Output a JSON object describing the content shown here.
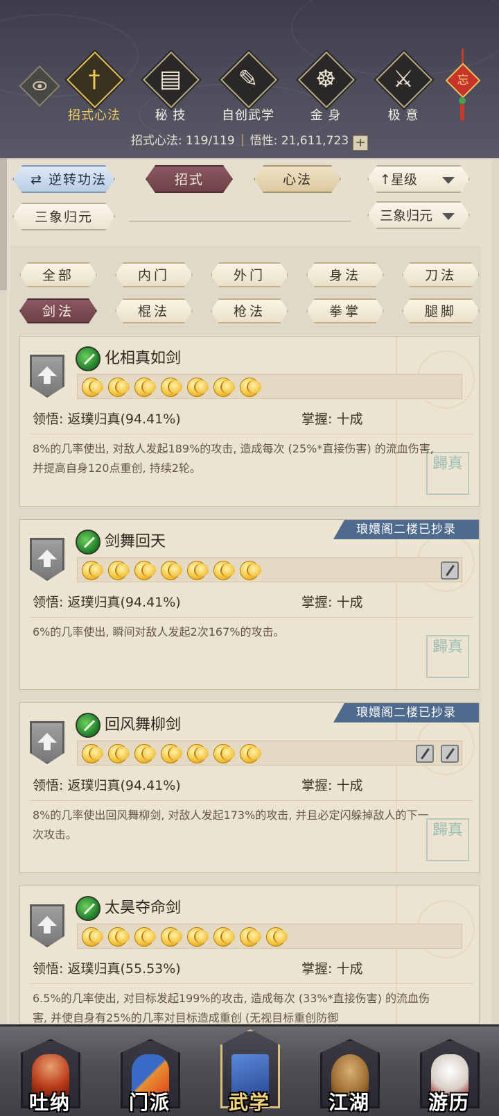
{
  "header": {
    "tabs": [
      {
        "label": "招式心法",
        "icon": "sword-icon",
        "glyph": "†",
        "active": true
      },
      {
        "label": "秘 技",
        "icon": "book-icon",
        "glyph": "▤",
        "active": false
      },
      {
        "label": "自创武学",
        "icon": "scroll-icon",
        "glyph": "✎",
        "active": false
      },
      {
        "label": "金 身",
        "icon": "meditation-icon",
        "glyph": "☸",
        "active": false
      },
      {
        "label": "极 意",
        "icon": "martial-stance-icon",
        "glyph": "⚔",
        "active": false
      }
    ],
    "charm_text": "忘",
    "stats": {
      "skill_label": "招式心法: 119/119",
      "insight_label": "悟性: 21,611,723",
      "plus": "+"
    }
  },
  "controls": {
    "reverse_button": "逆转功法",
    "moves_tab": "招式",
    "heart_tab": "心法",
    "sort_select": "星级",
    "sort_arrow": "↑",
    "left_filter": "三象归元",
    "right_select": "三象归元"
  },
  "categories": [
    {
      "label": "全部",
      "active": false
    },
    {
      "label": "内门",
      "active": false
    },
    {
      "label": "外门",
      "active": false
    },
    {
      "label": "身法",
      "active": false
    },
    {
      "label": "刀法",
      "active": false
    },
    {
      "label": "剑法",
      "active": true
    },
    {
      "label": "棍法",
      "active": false
    },
    {
      "label": "枪法",
      "active": false
    },
    {
      "label": "拳掌",
      "active": false
    },
    {
      "label": "腿脚",
      "active": false
    }
  ],
  "skills": [
    {
      "name": "化相真如剑",
      "stars": 7,
      "comprehension": "领悟: 返璞归真(94.41%)",
      "mastery": "掌握: 十成",
      "description": "8%的几率使出, 对敌人发起189%的攻击, 造成每次 (25%*直接伤害) 的流血伤害, 并提高自身120点重创, 持续2轮。",
      "ribbon": "",
      "record_icons": 0
    },
    {
      "name": "剑舞回天",
      "stars": 7,
      "comprehension": "领悟: 返璞归真(94.41%)",
      "mastery": "掌握: 十成",
      "description": "6%的几率使出, 瞬间对敌人发起2次167%的攻击。",
      "ribbon": "琅嬛阁二楼已抄录",
      "record_icons": 1
    },
    {
      "name": "回风舞柳剑",
      "stars": 7,
      "comprehension": "领悟: 返璞归真(94.41%)",
      "mastery": "掌握: 十成",
      "description": "8%的几率使出回风舞柳剑, 对敌人发起173%的攻击, 并且必定闪躲掉敌人的下一次攻击。",
      "ribbon": "琅嬛阁二楼已抄录",
      "record_icons": 2
    },
    {
      "name": "太昊夺命剑",
      "stars": 8,
      "comprehension": "领悟: 返璞归真(55.53%)",
      "mastery": "掌握: 十成",
      "description": "6.5%的几率使出, 对目标发起199%的攻击, 造成每次 (33%*直接伤害) 的流血伤害, 并使自身有25%的几率对目标造成重创 (无视目标重创防御",
      "ribbon": "",
      "record_icons": 0
    }
  ],
  "seal_text": "歸真",
  "bottom_nav": [
    {
      "label": "吐纳",
      "icon": "monk-icon",
      "active": false
    },
    {
      "label": "门派",
      "icon": "sect-flags-icon",
      "active": false
    },
    {
      "label": "武学",
      "icon": "martial-books-icon",
      "active": true
    },
    {
      "label": "江湖",
      "icon": "straw-hat-icon",
      "active": false
    },
    {
      "label": "游历",
      "icon": "horse-icon",
      "active": false
    }
  ]
}
